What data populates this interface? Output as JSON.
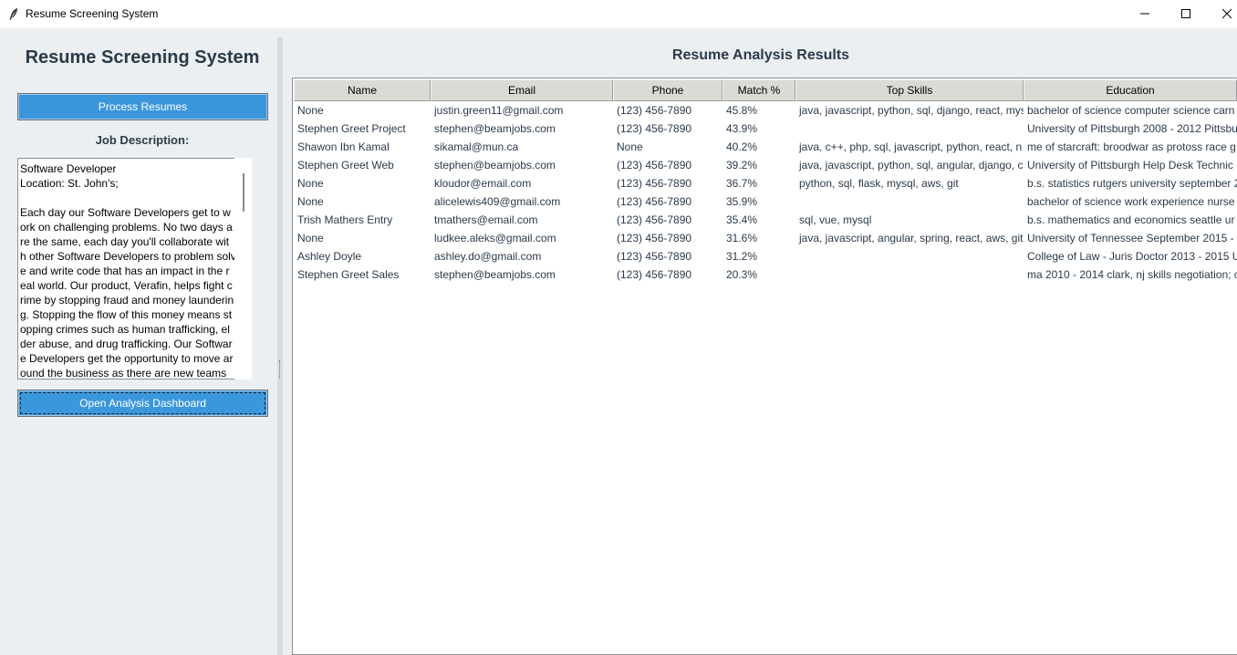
{
  "window": {
    "title": "Resume Screening System",
    "app_icon": "feather-icon",
    "controls": [
      "minimize-icon",
      "maximize-icon",
      "close-icon"
    ]
  },
  "left_panel": {
    "title": "Resume Screening System",
    "process_button": "Process Resumes",
    "job_description_label": "Job Description:",
    "job_description_lines": [
      "Software Developer",
      "Location: St. John's;",
      "",
      "Each day our Software Developers get to w",
      "ork on challenging problems. No two days a",
      "re the same, each day you'll collaborate wit",
      "h other Software Developers to problem solv",
      "e and write code that has an impact in the r",
      "eal world. Our product, Verafin, helps fight c",
      "rime by stopping fraud and money launderin",
      "g. Stopping the flow of this money means st",
      "opping crimes such as human trafficking, el",
      "der abuse, and drug trafficking. Our Softwar",
      "e Developers get the opportunity to move ar",
      "ound the business as there are new teams"
    ],
    "dashboard_button": "Open Analysis Dashboard"
  },
  "results": {
    "title": "Resume Analysis Results",
    "columns": [
      "Name",
      "Email",
      "Phone",
      "Match %",
      "Top Skills",
      "Education"
    ],
    "rows": [
      [
        "None",
        "justin.green11@gmail.com",
        "(123) 456-7890",
        "45.8%",
        "java, javascript, python, sql, django, react, mys",
        "bachelor of science computer science carn"
      ],
      [
        "Stephen Greet Project",
        "stephen@beamjobs.com",
        "(123) 456-7890",
        "43.9%",
        "",
        "University of Pittsburgh 2008 - 2012 Pittsbu"
      ],
      [
        "Shawon Ibn Kamal",
        "sikamal@mun.ca",
        "None",
        "40.2%",
        "java, c++, php, sql, javascript, python, react, n",
        "me of starcraft: broodwar as protoss race g"
      ],
      [
        "Stephen Greet Web",
        "stephen@beamjobs.com",
        "(123) 456-7890",
        "39.2%",
        "java, javascript, python, sql, angular, django, c",
        "University of Pittsburgh Help Desk Technic"
      ],
      [
        "None",
        "kloudor@email.com",
        "(123) 456-7890",
        "36.7%",
        "python, sql, flask, mysql, aws, git",
        "b.s. statistics rutgers university september 2"
      ],
      [
        "None",
        "alicelewis409@gmail.com",
        "(123) 456-7890",
        "35.9%",
        "",
        "bachelor of science work experience nurse"
      ],
      [
        "Trish Mathers Entry",
        "tmathers@email.com",
        "(123) 456-7890",
        "35.4%",
        "sql, vue, mysql",
        "b.s. mathematics and economics seattle ur"
      ],
      [
        "None",
        "ludkee.aleks@gmail.com",
        "(123) 456-7890",
        "31.6%",
        "java, javascript, angular, spring, react, aws, git",
        "University of Tennessee September 2015 - 2"
      ],
      [
        "Ashley Doyle",
        "ashley.do@gmail.com",
        "(123) 456-7890",
        "31.2%",
        "",
        "College of Law - Juris Doctor 2013 - 2015 U"
      ],
      [
        "Stephen Greet Sales",
        "stephen@beamjobs.com",
        "(123) 456-7890",
        "20.3%",
        "",
        "ma 2010 - 2014 clark, nj skills negotiation; c"
      ]
    ]
  },
  "colors": {
    "button_blue": "#3b97dc",
    "heading_text": "#2b3a4a",
    "panel_bg": "#eceff1",
    "header_bg": "#dcdad5"
  }
}
